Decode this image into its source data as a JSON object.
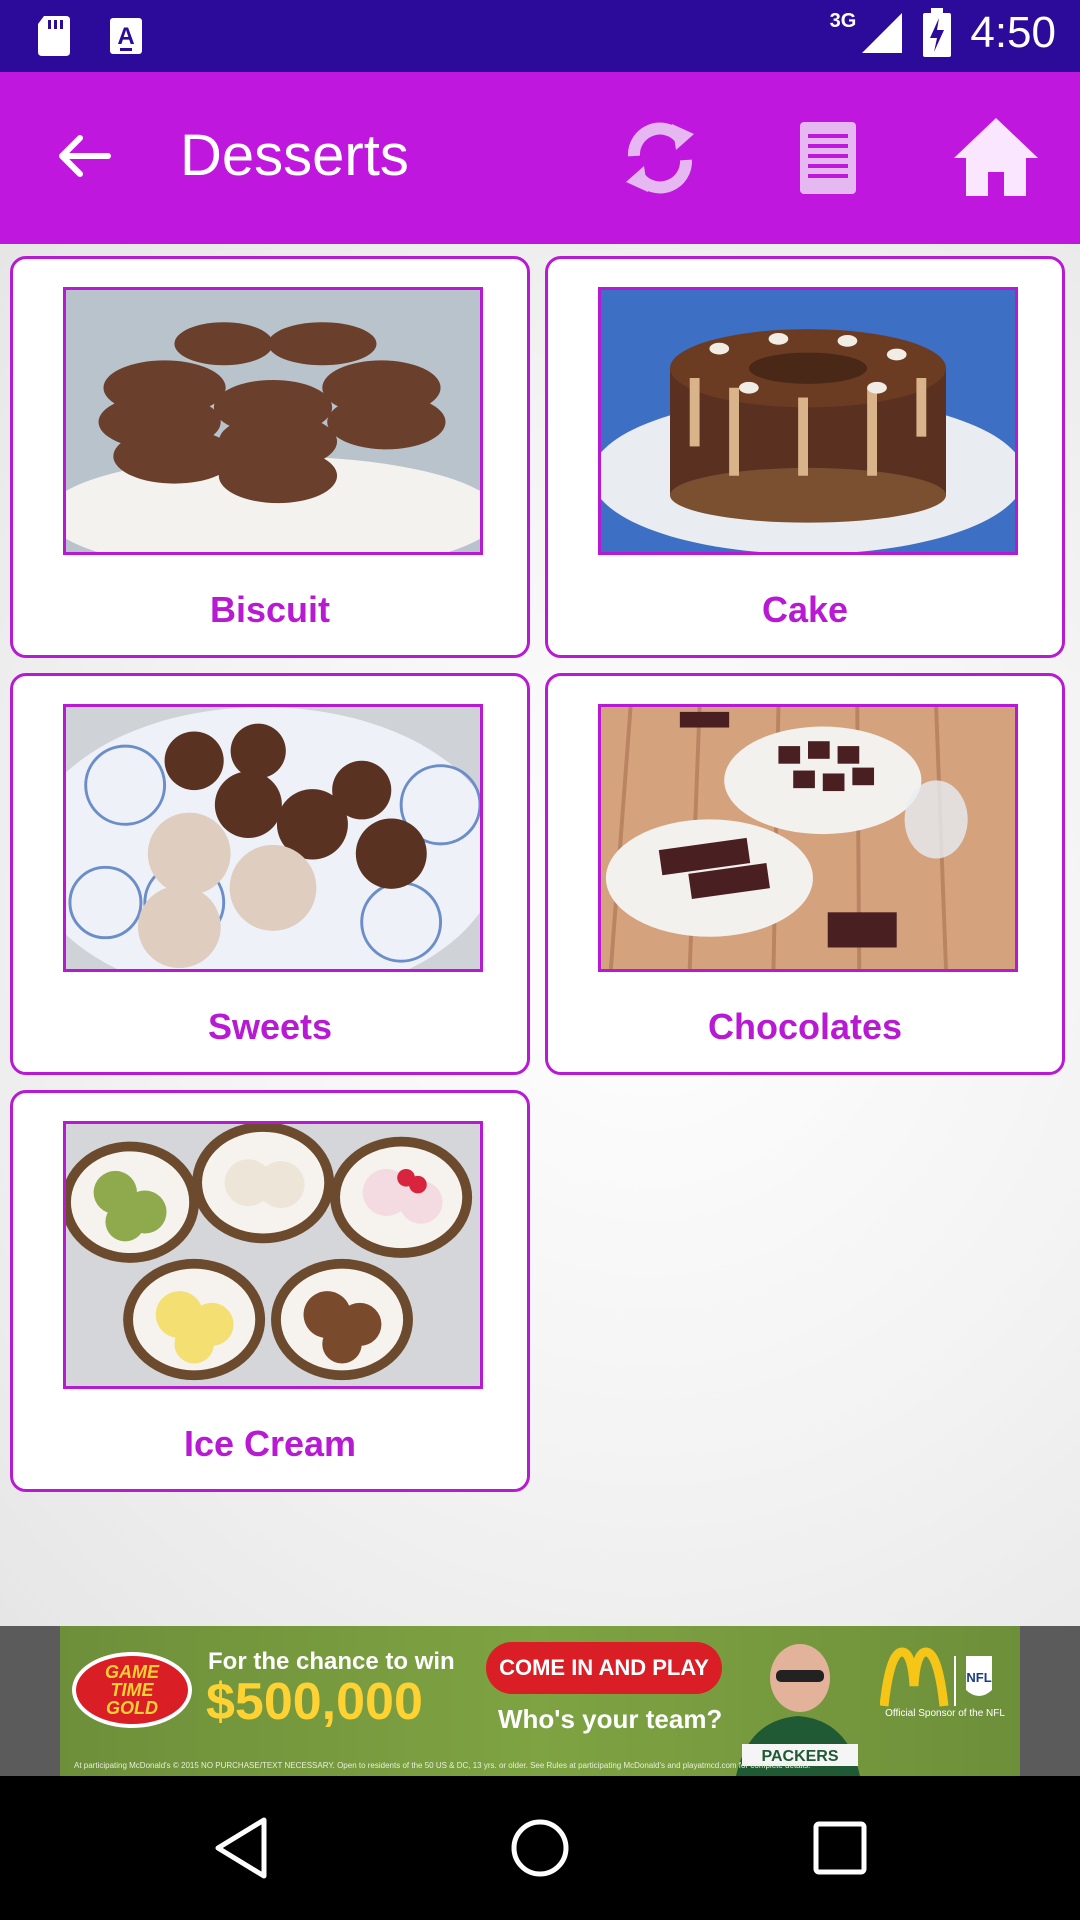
{
  "status_bar": {
    "time": "4:50",
    "network": "3G",
    "icons": [
      "sd-card-icon",
      "font-a-icon",
      "signal-icon",
      "battery-charging-icon"
    ]
  },
  "toolbar": {
    "title": "Desserts",
    "back_icon": "arrow-left-icon",
    "actions": [
      "refresh-icon",
      "list-icon",
      "home-icon"
    ],
    "background_color": "#bf17dd"
  },
  "categories": [
    {
      "label": "Biscuit",
      "image": "chocolate cookies stacked on a white cake stand"
    },
    {
      "label": "Cake",
      "image": "chocolate cake with caramel drip and nuts"
    },
    {
      "label": "Sweets",
      "image": "coconut and chocolate truffles on a patterned plate"
    },
    {
      "label": "Chocolates",
      "image": "chocolate pieces on plates on a wooden table"
    },
    {
      "label": "Ice Cream",
      "image": "scoops of ice cream served in coconut halves"
    }
  ],
  "ad": {
    "badge_line1": "GAME",
    "badge_line2": "TIME",
    "badge_line3": "GOLD",
    "chance_text": "For the chance to win",
    "amount": "$500,000",
    "cta": "COME IN AND PLAY",
    "team_question": "Who's your team?",
    "jersey": "PACKERS",
    "sponsor_text": "Official Sponsor of the NFL",
    "fine_print": "At participating McDonald's © 2015 NO PURCHASE/TEXT NECESSARY. Open to residents of the 50 US & DC, 13 yrs. or older. See Rules at participating McDonald's and playatmcd.com for complete details."
  },
  "colors": {
    "status_bar": "#2c0a9a",
    "accent": "#b81ad4",
    "nav_bar": "#000000"
  }
}
